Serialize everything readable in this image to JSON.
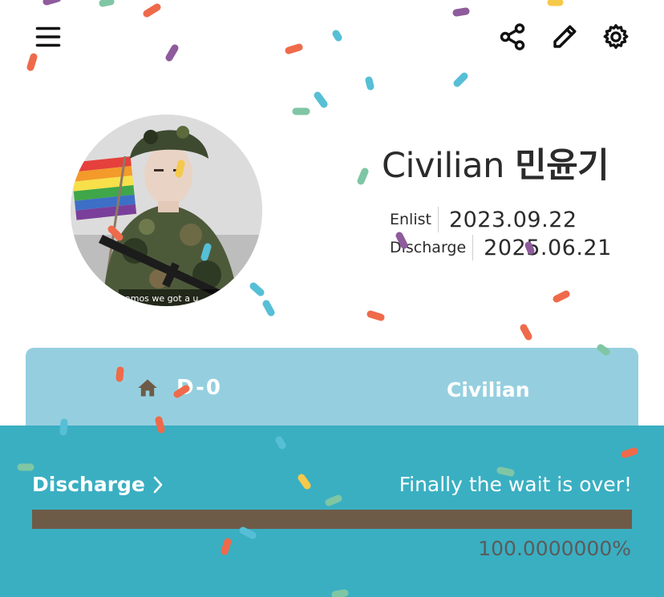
{
  "header": {
    "menu_icon": "hamburger-menu-icon",
    "share_icon": "share-icon",
    "edit_icon": "pencil-icon",
    "settings_icon": "gear-icon"
  },
  "profile": {
    "name_prefix": "Civilian",
    "name_korean": "민윤기",
    "avatar_caption": "amos we got a u",
    "enlist_label": "Enlist",
    "enlist_date": "2023.09.22",
    "discharge_label": "Discharge",
    "discharge_date": "2025.06.21"
  },
  "status": {
    "home_icon": "home-icon",
    "dday": "D-0",
    "rank": "Civilian"
  },
  "progress": {
    "link_label": "Discharge",
    "chevron_icon": "chevron-right-icon",
    "message": "Finally the wait is over!",
    "percent_text": "100.0000000%",
    "fraction": 1.0
  },
  "colors": {
    "card": "#95cfdf",
    "panel": "#3aafc2",
    "progress_fill": "#6e5b47",
    "home_icon": "#6e5b47"
  }
}
